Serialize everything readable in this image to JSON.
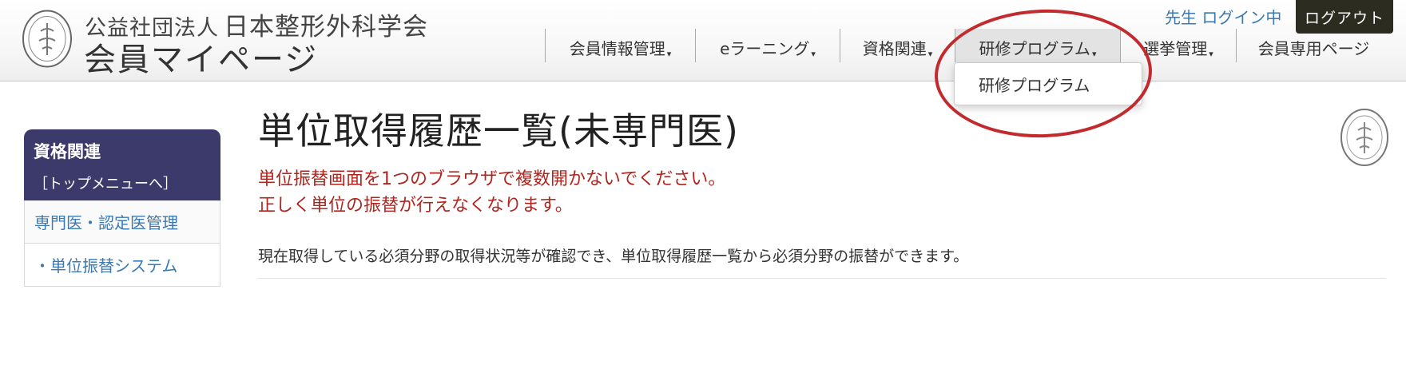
{
  "header": {
    "org_prefix": "公益社団法人",
    "org_name": "日本整形外科学会",
    "site_title": "会員マイページ",
    "login_status": "先生 ログイン中",
    "logout_label": "ログアウト"
  },
  "nav": {
    "items": [
      {
        "label": "会員情報管理"
      },
      {
        "label": "eラーニング"
      },
      {
        "label": "資格関連"
      },
      {
        "label": "研修プログラム"
      },
      {
        "label": "選挙管理"
      },
      {
        "label": "会員専用ページ"
      }
    ],
    "caret": "▾",
    "dropdown_item": "研修プログラム"
  },
  "sidebar": {
    "title": "資格関連",
    "top_link": "［トップメニューへ］",
    "items": [
      {
        "label": "専門医・認定医管理"
      },
      {
        "label": "・単位振替システム"
      }
    ]
  },
  "main": {
    "title": "単位取得履歴一覧(未専門医)",
    "warning_line1": "単位振替画面を1つのブラウザで複数開かないでください。",
    "warning_line2": "正しく単位の振替が行えなくなります。",
    "description": "現在取得している必須分野の取得状況等が確認でき、単位取得履歴一覧から必須分野の振替ができます。"
  },
  "colors": {
    "sidebar_header": "#3c3a6b",
    "link": "#3a79b3",
    "warning": "#b0251d",
    "annotation": "#c22a2e",
    "logout_bg": "#2c2c20"
  }
}
